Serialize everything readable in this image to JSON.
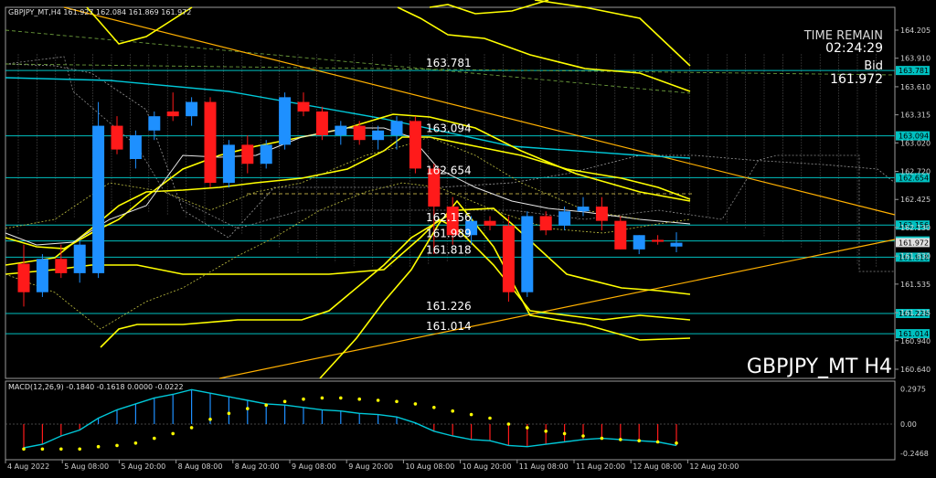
{
  "window": {
    "title": "GBPJPY_MT,H4  161.927 162.084 161.869 161.972",
    "watermark": "GBPJPY_MT H4"
  },
  "info_panel": {
    "time_remain_label": "TIME REMAIN",
    "time_remain_value": "02:24:29",
    "bid_label": "Bid",
    "bid_value": "161.972"
  },
  "price_axis": [
    "164.205",
    "163.910",
    "163.610",
    "163.315",
    "163.020",
    "162.720",
    "162.425",
    "162.130",
    "161.830",
    "161.535",
    "161.235",
    "160.940",
    "160.640"
  ],
  "level_labels": [
    {
      "price": 163.781,
      "text": "163.781",
      "color": "#00c0c0"
    },
    {
      "price": 163.094,
      "text": "163.094",
      "color": "#00c0c0"
    },
    {
      "price": 162.654,
      "text": "162.654",
      "color": "#00c0c0"
    },
    {
      "price": 162.156,
      "text": "162.156",
      "color": "#00c0c0"
    },
    {
      "price": 161.989,
      "text": "161.989",
      "color": "#00c0c0"
    },
    {
      "price": 161.818,
      "text": "161.818",
      "color": "#00c0c0"
    },
    {
      "price": 161.226,
      "text": "161.226",
      "color": "#00c0c0"
    },
    {
      "price": 161.014,
      "text": "161.014",
      "color": "#00c0c0"
    }
  ],
  "macd": {
    "label": "MACD(12,26,9) -0.1840 -0.1618 0.0000 -0.0222",
    "axis": [
      "0.2975",
      "0.00",
      "-0.2468"
    ],
    "zero_label": "0.00"
  },
  "time_axis": [
    "4 Aug 2022",
    "5 Aug 08:00",
    "5 Aug 20:00",
    "8 Aug 08:00",
    "8 Aug 20:00",
    "9 Aug 08:00",
    "9 Aug 20:00",
    "10 Aug 08:00",
    "10 Aug 20:00",
    "11 Aug 08:00",
    "11 Aug 20:00",
    "12 Aug 08:00",
    "12 Aug 20:00"
  ],
  "colors": {
    "background": "#000000",
    "bull": "#1e90ff",
    "bear": "#ff1a1a",
    "level_line": "#00c0c0",
    "ma_line": "#ffff00",
    "trend_line": "#ffb000"
  },
  "chart_data": {
    "type": "candlestick",
    "symbol": "GBPJPY_MT",
    "timeframe": "H4",
    "y_range": [
      160.64,
      164.205
    ],
    "candles": [
      {
        "o": 161.75,
        "h": 161.95,
        "l": 161.3,
        "c": 161.45
      },
      {
        "o": 161.45,
        "h": 161.85,
        "l": 161.4,
        "c": 161.8
      },
      {
        "o": 161.8,
        "h": 161.95,
        "l": 161.6,
        "c": 161.65
      },
      {
        "o": 161.65,
        "h": 162.0,
        "l": 161.55,
        "c": 161.95
      },
      {
        "o": 161.65,
        "h": 163.45,
        "l": 161.6,
        "c": 163.2
      },
      {
        "o": 163.2,
        "h": 163.3,
        "l": 162.9,
        "c": 162.95
      },
      {
        "o": 162.85,
        "h": 163.15,
        "l": 162.75,
        "c": 163.1
      },
      {
        "o": 163.15,
        "h": 163.35,
        "l": 163.05,
        "c": 163.3
      },
      {
        "o": 163.35,
        "h": 163.55,
        "l": 163.25,
        "c": 163.3
      },
      {
        "o": 163.3,
        "h": 163.5,
        "l": 163.2,
        "c": 163.45
      },
      {
        "o": 163.45,
        "h": 163.5,
        "l": 162.55,
        "c": 162.6
      },
      {
        "o": 162.6,
        "h": 163.05,
        "l": 162.55,
        "c": 163.0
      },
      {
        "o": 163.0,
        "h": 163.1,
        "l": 162.7,
        "c": 162.8
      },
      {
        "o": 162.8,
        "h": 163.05,
        "l": 162.75,
        "c": 163.0
      },
      {
        "o": 163.0,
        "h": 163.55,
        "l": 162.95,
        "c": 163.5
      },
      {
        "o": 163.45,
        "h": 163.55,
        "l": 163.3,
        "c": 163.35
      },
      {
        "o": 163.35,
        "h": 163.4,
        "l": 163.05,
        "c": 163.1
      },
      {
        "o": 163.1,
        "h": 163.25,
        "l": 163.0,
        "c": 163.2
      },
      {
        "o": 163.2,
        "h": 163.25,
        "l": 163.0,
        "c": 163.05
      },
      {
        "o": 163.05,
        "h": 163.2,
        "l": 162.95,
        "c": 163.15
      },
      {
        "o": 163.1,
        "h": 163.3,
        "l": 162.95,
        "c": 163.25
      },
      {
        "o": 163.25,
        "h": 163.3,
        "l": 162.7,
        "c": 162.75
      },
      {
        "o": 162.75,
        "h": 162.8,
        "l": 161.85,
        "c": 162.35
      },
      {
        "o": 162.35,
        "h": 162.45,
        "l": 161.95,
        "c": 162.05
      },
      {
        "o": 162.05,
        "h": 162.25,
        "l": 161.95,
        "c": 162.2
      },
      {
        "o": 162.2,
        "h": 162.25,
        "l": 162.1,
        "c": 162.15
      },
      {
        "o": 162.15,
        "h": 162.25,
        "l": 161.35,
        "c": 161.45
      },
      {
        "o": 161.45,
        "h": 162.3,
        "l": 161.4,
        "c": 162.25
      },
      {
        "o": 162.25,
        "h": 162.3,
        "l": 162.05,
        "c": 162.1
      },
      {
        "o": 162.15,
        "h": 162.35,
        "l": 162.1,
        "c": 162.3
      },
      {
        "o": 162.3,
        "h": 162.45,
        "l": 162.25,
        "c": 162.35
      },
      {
        "o": 162.35,
        "h": 162.45,
        "l": 162.1,
        "c": 162.2
      },
      {
        "o": 162.2,
        "h": 162.25,
        "l": 161.9,
        "c": 161.9
      },
      {
        "o": 161.9,
        "h": 162.05,
        "l": 161.85,
        "c": 162.05
      },
      {
        "o": 162.0,
        "h": 162.05,
        "l": 161.95,
        "c": 161.98
      },
      {
        "o": 161.93,
        "h": 162.08,
        "l": 161.87,
        "c": 161.97
      }
    ],
    "macd_hist": [
      -0.2,
      -0.17,
      -0.1,
      -0.05,
      0.05,
      0.12,
      0.17,
      0.22,
      0.25,
      0.29,
      0.26,
      0.23,
      0.2,
      0.17,
      0.16,
      0.14,
      0.12,
      0.11,
      0.09,
      0.08,
      0.06,
      0.01,
      -0.06,
      -0.1,
      -0.13,
      -0.14,
      -0.18,
      -0.19,
      -0.17,
      -0.15,
      -0.13,
      -0.12,
      -0.13,
      -0.14,
      -0.15,
      -0.18
    ],
    "macd_signal": [
      -0.21,
      -0.21,
      -0.21,
      -0.21,
      -0.19,
      -0.18,
      -0.16,
      -0.12,
      -0.08,
      -0.03,
      0.04,
      0.09,
      0.13,
      0.16,
      0.19,
      0.21,
      0.22,
      0.22,
      0.21,
      0.2,
      0.19,
      0.17,
      0.14,
      0.11,
      0.08,
      0.05,
      0.0,
      -0.03,
      -0.06,
      -0.08,
      -0.1,
      -0.12,
      -0.13,
      -0.14,
      -0.15,
      -0.16
    ]
  }
}
